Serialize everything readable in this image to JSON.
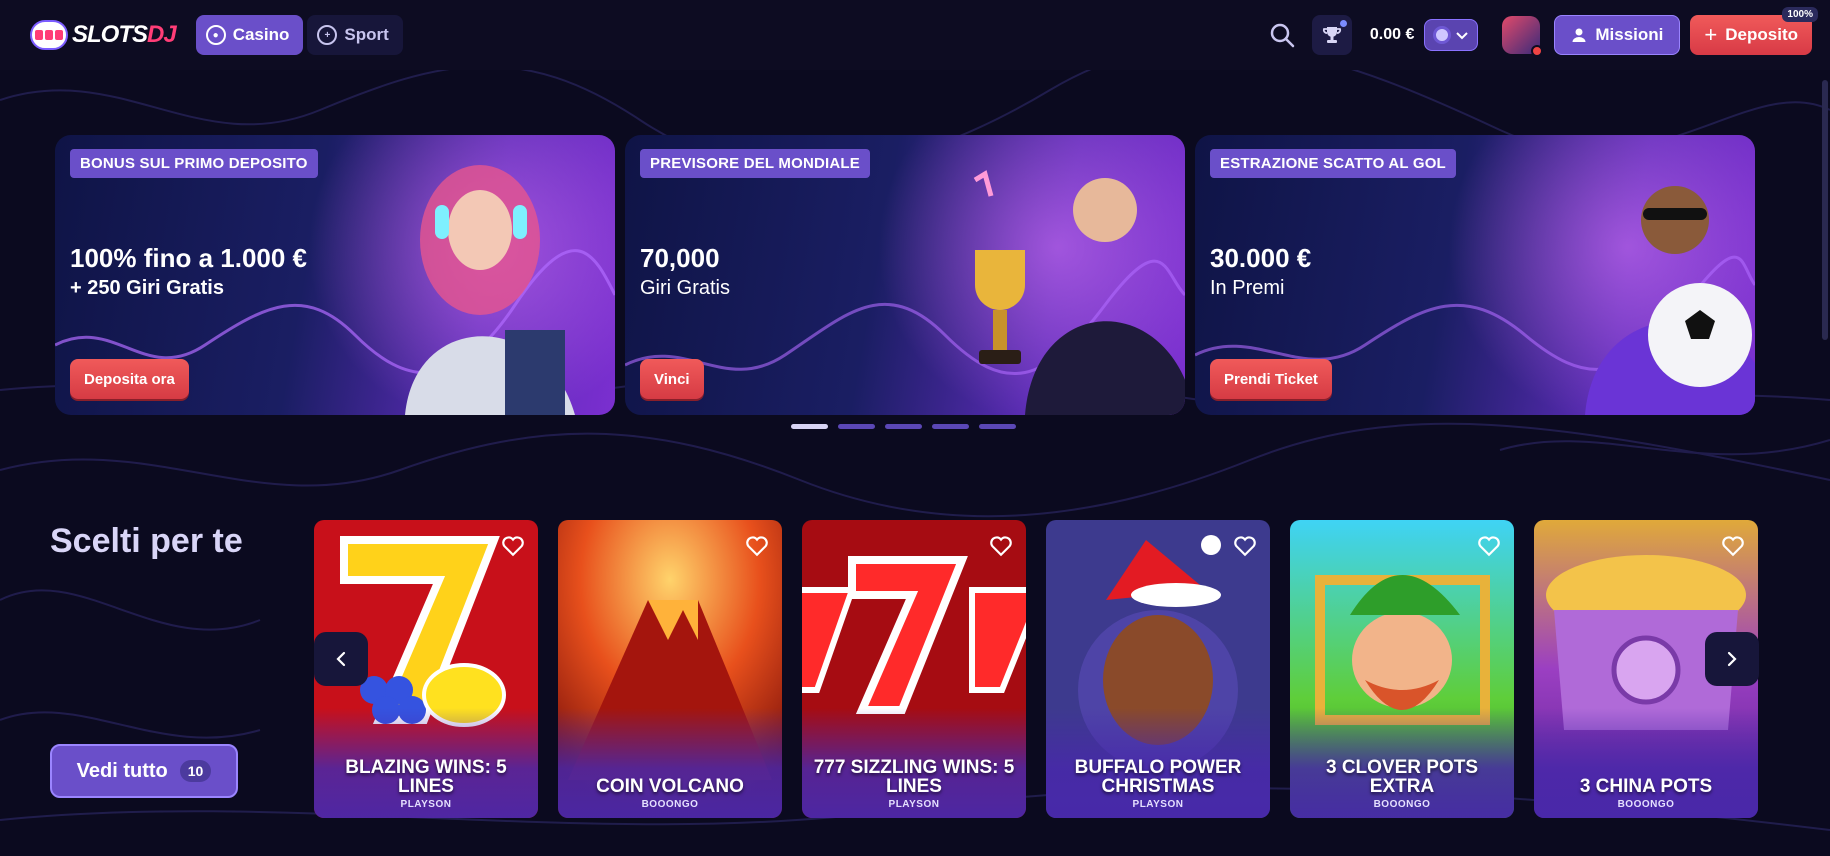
{
  "header": {
    "logo_text": "SLOTS",
    "logo_accent": "DJ",
    "nav": {
      "casino": "Casino",
      "sport": "Sport"
    },
    "balance": "0.00 €",
    "missions_label": "Missioni",
    "deposit_label": "Deposito",
    "deposit_badge": "100%"
  },
  "banners": [
    {
      "tag": "BONUS SUL PRIMO DEPOSITO",
      "title": "100% fino a 1.000 €",
      "subtitle": "+ 250 Giri Gratis",
      "cta": "Deposita ora"
    },
    {
      "tag": "PREVISORE DEL MONDIALE",
      "title": "70,000",
      "subtitle": "Giri Gratis",
      "cta": "Vinci"
    },
    {
      "tag": "ESTRAZIONE SCATTO AL GOL",
      "title": "30.000 €",
      "subtitle": "In Premi",
      "cta": "Prendi Ticket"
    }
  ],
  "section": {
    "title": "Scelti per te",
    "view_all_label": "Vedi tutto",
    "view_all_count": "10"
  },
  "games": [
    {
      "name": "BLAZING WINS: 5 LINES",
      "provider": "PLAYSON"
    },
    {
      "name": "COIN VOLCANO",
      "provider": "BOOONGO"
    },
    {
      "name": "777 SIZZLING WINS: 5 LINES",
      "provider": "PLAYSON"
    },
    {
      "name": "BUFFALO POWER CHRISTMAS",
      "provider": "PLAYSON"
    },
    {
      "name": "3 CLOVER POTS EXTRA",
      "provider": "BOOONGO"
    },
    {
      "name": "3 CHINA POTS",
      "provider": "BOOONGO"
    }
  ],
  "colors": {
    "background": "#0b0a1f",
    "accent_purple": "#6a4fc9",
    "cta_red": "#e24a50"
  },
  "icons": [
    "search-icon",
    "trophy-icon",
    "user-icon",
    "plus-icon",
    "heart-icon",
    "chevron-left-icon",
    "chevron-right-icon",
    "chevron-down-icon"
  ]
}
